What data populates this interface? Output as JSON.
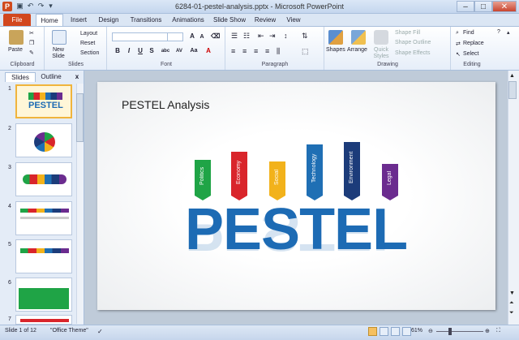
{
  "window": {
    "app_letter": "P",
    "title": "6284-01-pestel-analysis.pptx - Microsoft PowerPoint",
    "minimize": "–",
    "maximize": "□",
    "close": "✕"
  },
  "tabs": [
    "File",
    "Home",
    "Insert",
    "Design",
    "Transitions",
    "Animations",
    "Slide Show",
    "Review",
    "View"
  ],
  "ribbon": {
    "clipboard": {
      "label": "Clipboard",
      "paste": "Paste"
    },
    "slides": {
      "label": "Slides",
      "new_slide": "New Slide",
      "layout": "Layout",
      "reset": "Reset",
      "section": "Section"
    },
    "font": {
      "label": "Font",
      "bold": "B",
      "italic": "I",
      "underline": "U",
      "strike": "S",
      "shadow": "abc",
      "spacing": "AV",
      "case": "Aa",
      "grow": "A",
      "shrink": "A"
    },
    "paragraph": {
      "label": "Paragraph"
    },
    "drawing": {
      "label": "Drawing",
      "shapes": "Shapes",
      "arrange": "Arrange",
      "quick_styles": "Quick Styles",
      "shape_fill": "Shape Fill",
      "shape_outline": "Shape Outline",
      "shape_effects": "Shape Effects"
    },
    "editing": {
      "label": "Editing",
      "find": "Find",
      "replace": "Replace",
      "select": "Select"
    }
  },
  "panel": {
    "tab_slides": "Slides",
    "tab_outline": "Outline",
    "close": "x",
    "slide_numbers": [
      "1",
      "2",
      "3",
      "4",
      "5",
      "6",
      "7"
    ]
  },
  "slide": {
    "title": "PESTEL Analysis",
    "word": "PESTEL",
    "tags": [
      {
        "label": "Politics",
        "color": "#1fa446"
      },
      {
        "label": "Economy",
        "color": "#d9252b"
      },
      {
        "label": "Social",
        "color": "#f2b21b"
      },
      {
        "label": "Technology",
        "color": "#1f6fb4"
      },
      {
        "label": "Environment",
        "color": "#1c3c7a"
      },
      {
        "label": "Legal",
        "color": "#6b2c8f"
      }
    ]
  },
  "status": {
    "slide_count": "Slide 1 of 12",
    "theme": "\"Office Theme\"",
    "zoom": "61%"
  }
}
